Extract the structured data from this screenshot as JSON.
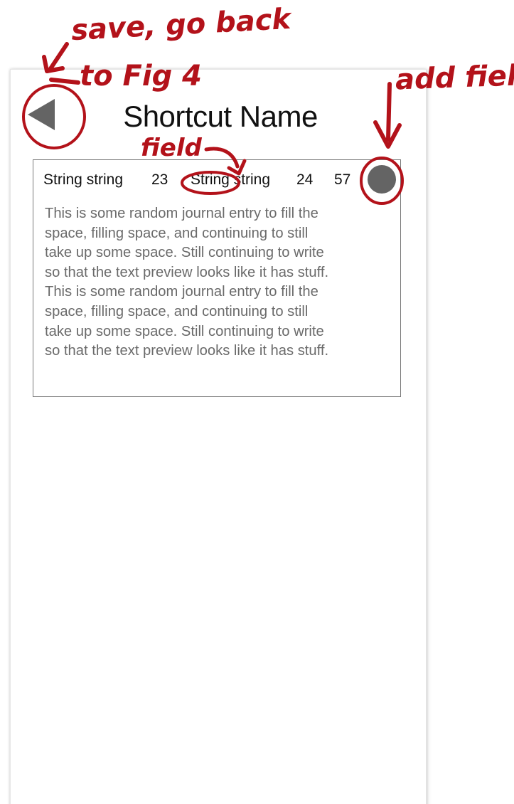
{
  "colors": {
    "annotation": "#b3121a",
    "title_text": "#111111",
    "preview_text": "#6a6a6a",
    "button_fill": "#646464",
    "card_border": "#7a7a7a"
  },
  "header": {
    "title": "Shortcut Name",
    "back_icon": "triangle-left-icon"
  },
  "entry": {
    "fields": [
      "String string",
      "23",
      "String string",
      "24",
      "57"
    ],
    "add_field_icon": "circle-button-icon",
    "preview_lines": [
      "This is some random journal entry to fill the",
      "space, filling space, and continuing to still",
      "take up some space. Still continuing to write",
      "so that the text preview looks like it has stuff.",
      "This is some random journal entry to fill the",
      "space, filling space, and continuing to still",
      "take up some space. Still continuing to write",
      "so that the text preview looks like it has stuff."
    ]
  },
  "annotations": {
    "save_note_line1": "save, go back",
    "save_note_line2": "to Fig 4",
    "field_note": "field",
    "add_field_note": "add field"
  }
}
